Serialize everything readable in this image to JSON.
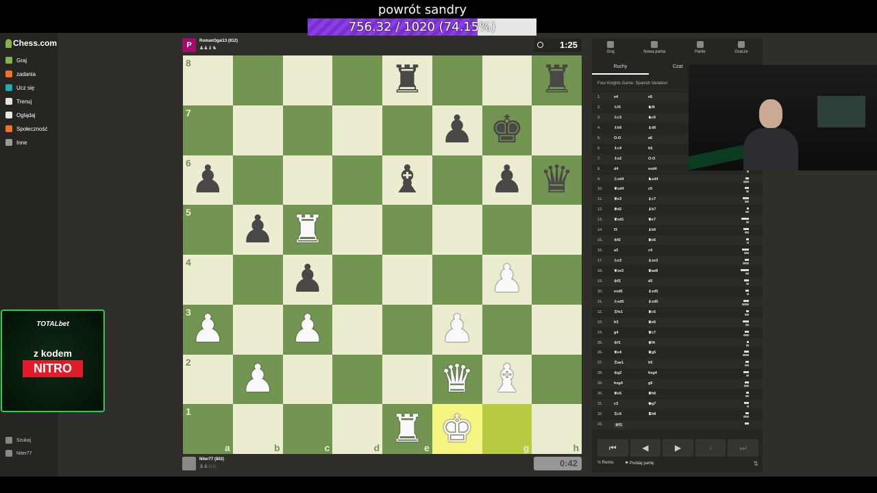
{
  "goal": {
    "title": "powrót sandry",
    "text": "756.32 / 1020 (74.15%)",
    "progress": 0.7415,
    "color": "#7a2fd0"
  },
  "sidebar": {
    "logo": "Chess.com",
    "items": [
      {
        "label": "Graj",
        "icon": "pawn-icon",
        "color": "#81b64c"
      },
      {
        "label": "zadania",
        "icon": "puzzle-icon",
        "color": "#f0712c"
      },
      {
        "label": "Ucz się",
        "icon": "learn-icon",
        "color": "#1baca6"
      },
      {
        "label": "Trenuj",
        "icon": "train-icon",
        "color": "#e5e5e5"
      },
      {
        "label": "Oglądaj",
        "icon": "watch-icon",
        "color": "#e5e5e5"
      },
      {
        "label": "Społeczność",
        "icon": "community-icon",
        "color": "#f0712c"
      },
      {
        "label": "Inne",
        "icon": "more-icon",
        "color": "#999999"
      }
    ],
    "bottom": [
      {
        "label": "Szukaj",
        "icon": "search-icon"
      },
      {
        "label": "Niter77",
        "icon": "avatar-icon"
      }
    ]
  },
  "ad": {
    "brand": "TOTALbet",
    "line1": "z kodem",
    "line2": "NITRO"
  },
  "players": {
    "top": {
      "avatar": "P",
      "name": "RomanOgai13 (812)",
      "captured": "♟♟♝♞",
      "clock": "1:25",
      "avatar_color": "#a40c6c"
    },
    "bottom": {
      "name": "Niter77 (802)",
      "captured": "♙♙♘♘",
      "clock": "0:42"
    }
  },
  "board": [
    [
      "",
      "",
      "",
      "",
      "br",
      "",
      "",
      "br"
    ],
    [
      "",
      "",
      "",
      "",
      "",
      "bp",
      "bk",
      ""
    ],
    [
      "bp",
      "",
      "",
      "",
      "bb",
      "",
      "bp",
      "bq"
    ],
    [
      "",
      "bp",
      "wr",
      "",
      "",
      "",
      "",
      ""
    ],
    [
      "",
      "",
      "bp",
      "",
      "",
      "",
      "wp",
      ""
    ],
    [
      "wp",
      "",
      "wp",
      "",
      "",
      "wp",
      "",
      ""
    ],
    [
      "",
      "wp",
      "",
      "",
      "",
      "wq",
      "wb",
      ""
    ],
    [
      "",
      "",
      "",
      "",
      "wr",
      "wk",
      "",
      ""
    ]
  ],
  "highlight": [
    "f1",
    "g1"
  ],
  "ranks": [
    "8",
    "7",
    "6",
    "5",
    "4",
    "3",
    "2",
    "1"
  ],
  "files": [
    "a",
    "b",
    "c",
    "d",
    "e",
    "f",
    "g",
    "h"
  ],
  "panel": {
    "nav": [
      "Graj",
      "Nowa partia",
      "Partie",
      "Gracze"
    ],
    "tabs": [
      "Ruchy",
      "Czat"
    ],
    "opening": "Four Knights Game: Spanish Variation",
    "moves": [
      [
        "1.",
        "e4",
        "e5"
      ],
      [
        "2.",
        "♘f3",
        "♞f6"
      ],
      [
        "3.",
        "♘c3",
        "♞c6"
      ],
      [
        "4.",
        "♗b5",
        "♝d6"
      ],
      [
        "5.",
        "O-O",
        "a6"
      ],
      [
        "6.",
        "♗c4",
        "b5"
      ],
      [
        "7.",
        "♗e2",
        "O-O"
      ],
      [
        "8.",
        "d4",
        "exd4"
      ],
      [
        "9.",
        "♘xd4",
        "♞xd4"
      ],
      [
        "10.",
        "♕xd4",
        "c5"
      ],
      [
        "11.",
        "♕e3",
        "♝c7"
      ],
      [
        "12.",
        "♕d2",
        "♝b7"
      ],
      [
        "13.",
        "♕xd1",
        "♛e7"
      ],
      [
        "14.",
        "f3",
        "♝b6"
      ],
      [
        "15.",
        "♔f2",
        "♛e6"
      ],
      [
        "16.",
        "a3",
        "c4"
      ],
      [
        "17.",
        "♘e3",
        "♝xe3"
      ],
      [
        "18.",
        "♕xe3",
        "♛ae8"
      ],
      [
        "19.",
        "♔f2",
        "d5"
      ],
      [
        "20.",
        "exd5",
        "♝xd5"
      ],
      [
        "21.",
        "♘xd5",
        "♝xd5"
      ],
      [
        "22.",
        "♖fe1",
        "♛c6"
      ],
      [
        "23.",
        "h3",
        "♛e6"
      ],
      [
        "24.",
        "g4",
        "♛c7"
      ],
      [
        "25.",
        "♔f1",
        "♛f4"
      ],
      [
        "26.",
        "♕e4",
        "♛g5"
      ],
      [
        "27.",
        "♖ae1",
        "h5"
      ],
      [
        "28.",
        "♔g2",
        "hxg4"
      ],
      [
        "29.",
        "hxg4",
        "g6"
      ],
      [
        "30.",
        "♕e5",
        "♛h6"
      ],
      [
        "31.",
        "c3",
        "♚g7"
      ],
      [
        "32.",
        "♖c5",
        "♜h8"
      ],
      [
        "33.",
        "♔f1",
        ""
      ]
    ],
    "controls": [
      "⏮",
      "◀",
      "▶",
      "›",
      "⏭"
    ],
    "draw_label": "Remis",
    "resign_label": "Poddaj partię"
  }
}
